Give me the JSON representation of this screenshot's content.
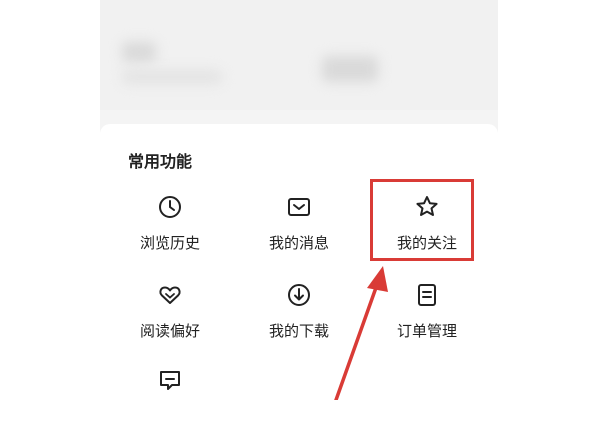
{
  "section": {
    "title": "常用功能"
  },
  "items": [
    {
      "label": "浏览历史",
      "icon": "clock-icon"
    },
    {
      "label": "我的消息",
      "icon": "message-box-icon"
    },
    {
      "label": "我的关注",
      "icon": "star-icon"
    },
    {
      "label": "阅读偏好",
      "icon": "heart-icon"
    },
    {
      "label": "我的下载",
      "icon": "download-icon"
    },
    {
      "label": "订单管理",
      "icon": "document-icon"
    }
  ],
  "annotation": {
    "highlight_color": "#d93b36"
  }
}
